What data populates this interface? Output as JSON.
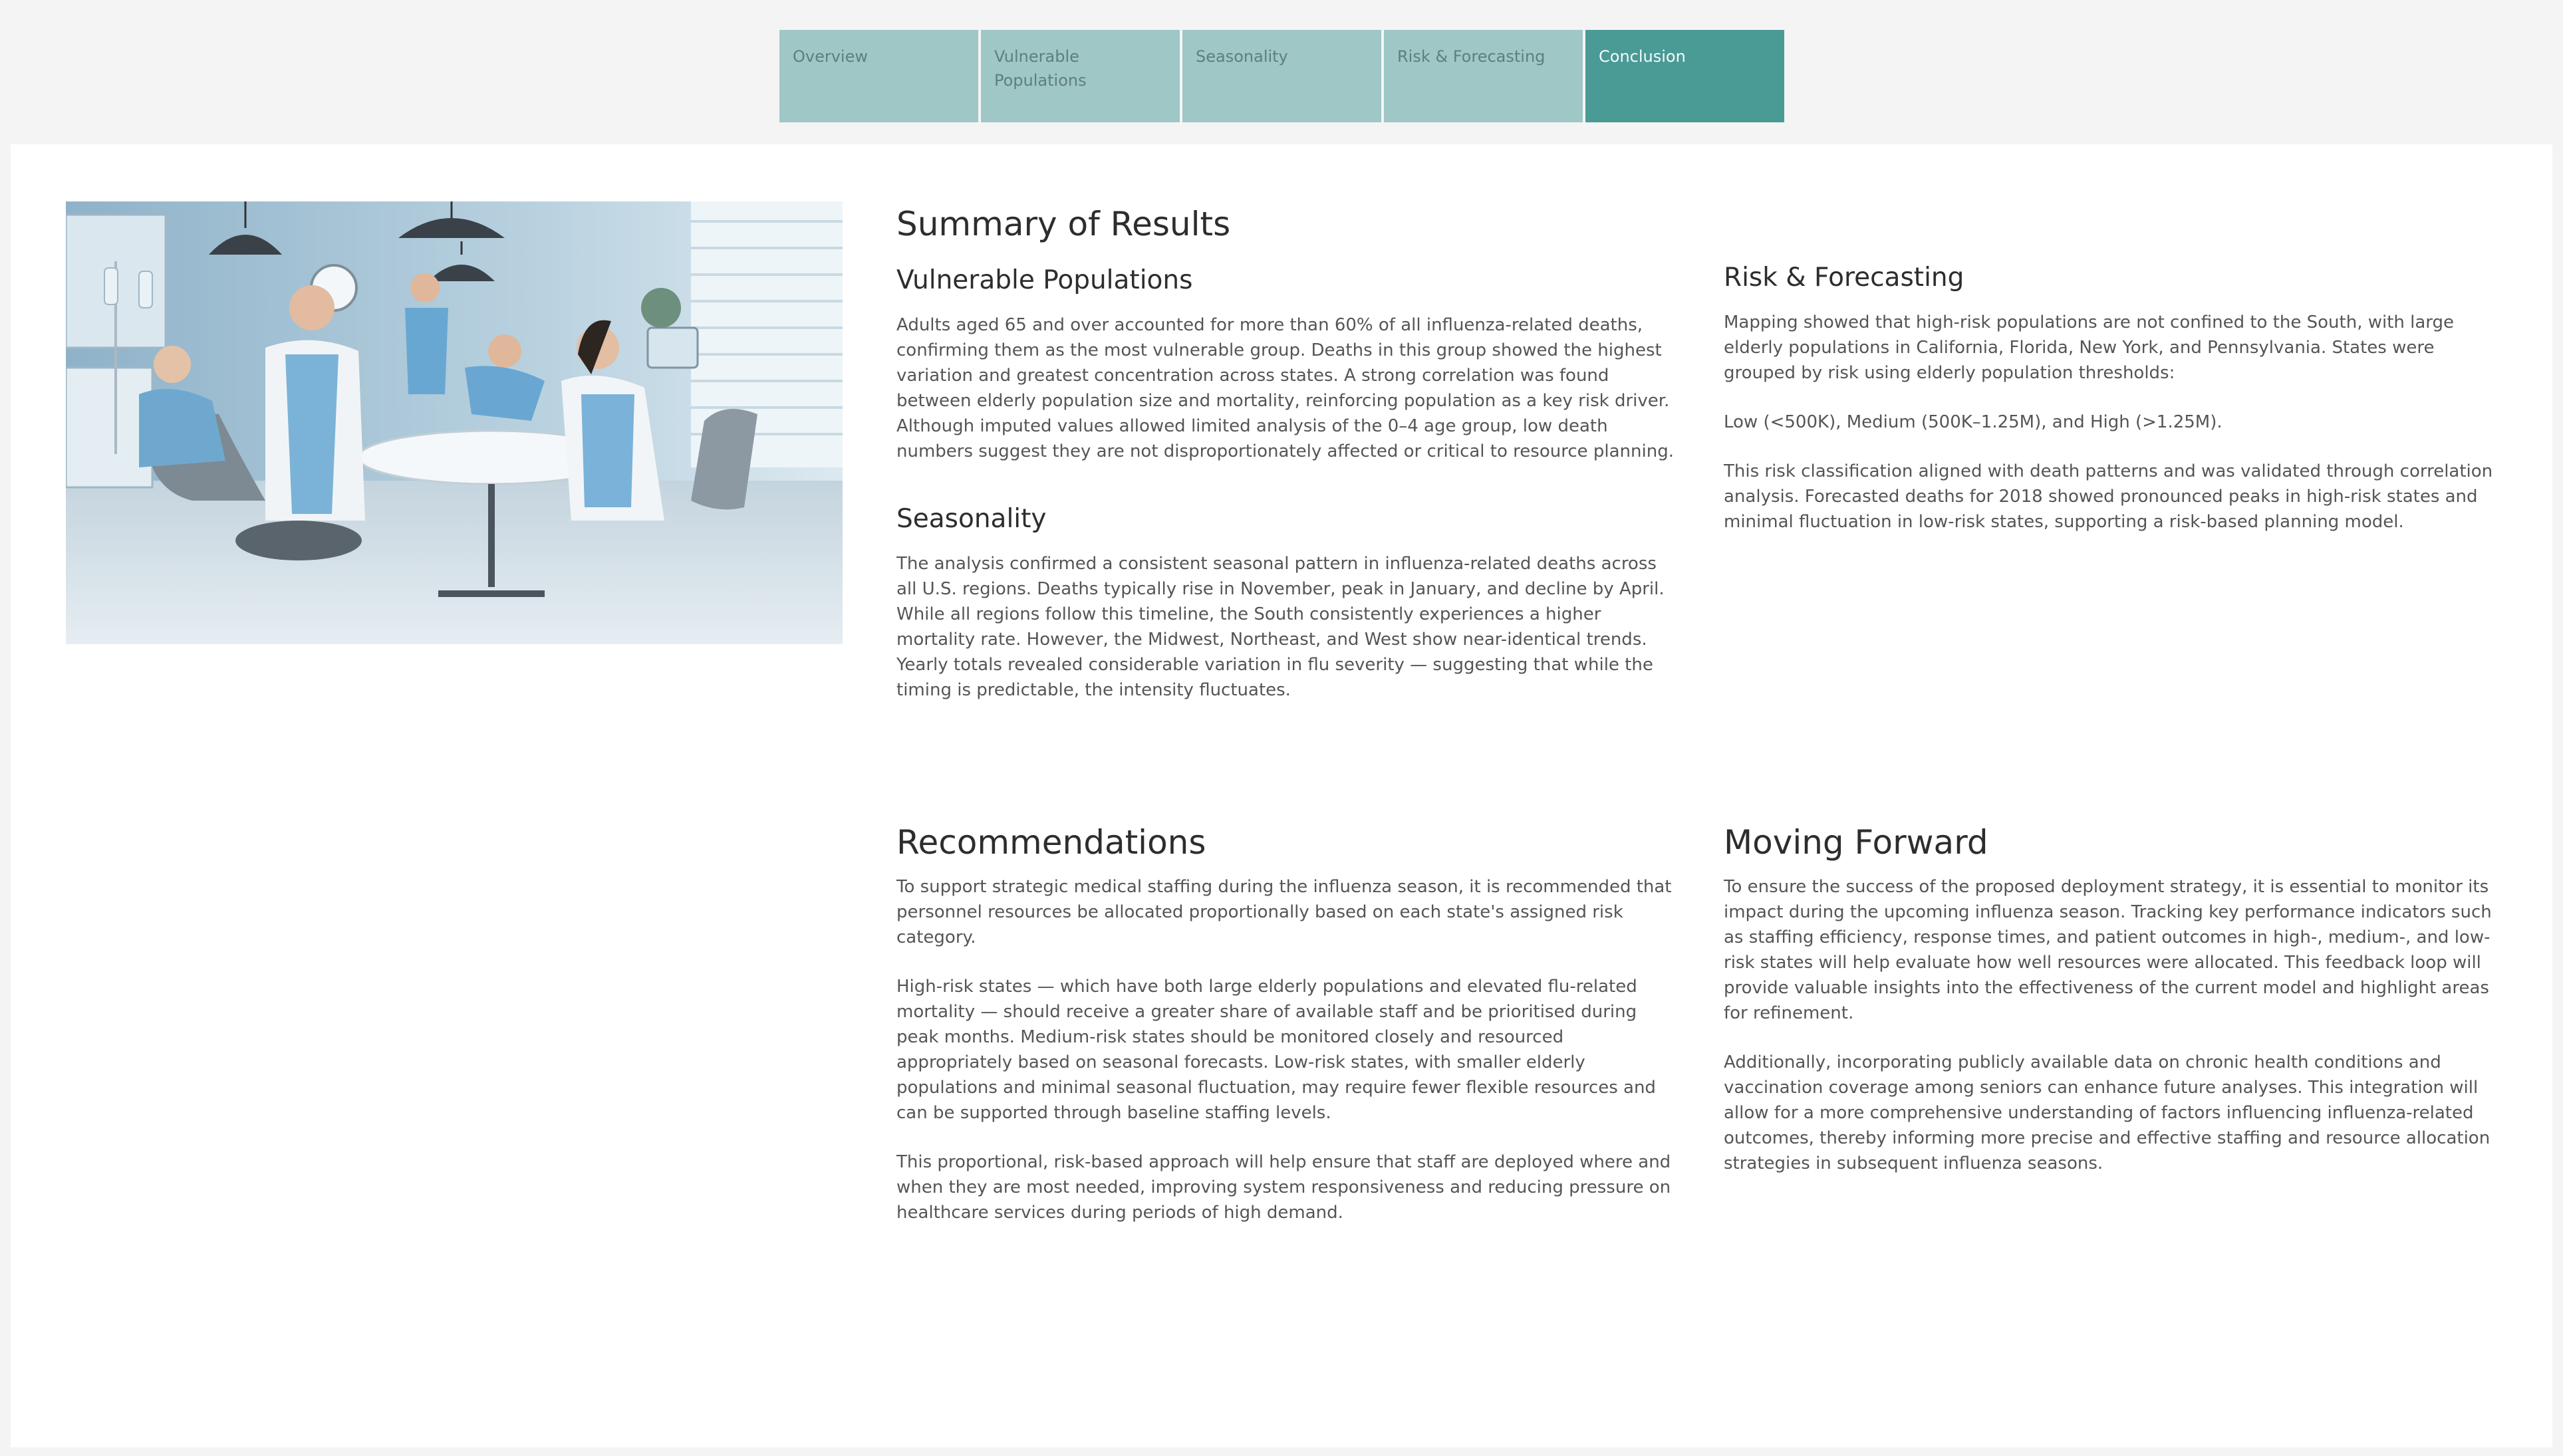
{
  "tabs": [
    {
      "label": "Overview",
      "active": false
    },
    {
      "label": "Vulnerable Populations",
      "active": false
    },
    {
      "label": "Seasonality",
      "active": false
    },
    {
      "label": "Risk & Forecasting",
      "active": false
    },
    {
      "label": "Conclusion",
      "active": true
    }
  ],
  "hero_image": {
    "icon": "medical-staff-lounge-illustration"
  },
  "summary": {
    "title": "Summary of Results",
    "vulnerable": {
      "heading": "Vulnerable Populations",
      "text": "Adults aged 65 and over accounted for more than 60% of all influenza-related deaths, confirming them as the most vulnerable group. Deaths in this group showed the highest variation and greatest concentration across states. A strong correlation was found between elderly population size and mortality, reinforcing population as a key risk driver. Although imputed values allowed limited analysis of the 0–4 age group, low death numbers suggest they are not disproportionately affected or critical to resource planning."
    },
    "seasonality": {
      "heading": "Seasonality",
      "text": "The analysis confirmed a consistent seasonal pattern in influenza-related deaths across all U.S. regions. Deaths typically rise in November, peak in January, and decline by April. While all regions follow this timeline, the South consistently experiences a higher mortality rate. However, the Midwest, Northeast, and West show near-identical trends. Yearly totals revealed considerable variation in flu severity — suggesting that while the timing is predictable, the intensity fluctuates."
    }
  },
  "risk": {
    "heading": "Risk & Forecasting",
    "p1": "Mapping showed that high-risk populations are not confined to the South, with large elderly populations in California, Florida, New York, and Pennsylvania. States were grouped by risk using elderly population thresholds:",
    "p2": "Low (<500K), Medium (500K–1.25M), and High (>1.25M).",
    "p3": "This risk classification aligned with death patterns and was validated through correlation analysis. Forecasted deaths for 2018 showed pronounced peaks in high-risk states and minimal fluctuation in low-risk states, supporting a risk-based planning model."
  },
  "recommendations": {
    "heading": "Recommendations",
    "p1": "To support strategic medical staffing during the influenza season, it is recommended that personnel resources be allocated proportionally based on each state's assigned risk category.",
    "p2": "High-risk states — which have both large elderly populations and elevated flu-related mortality — should receive a greater share of available staff and be prioritised during peak months. Medium-risk states should be monitored closely and resourced appropriately based on seasonal forecasts. Low-risk states, with smaller elderly populations and minimal seasonal fluctuation, may require fewer flexible resources and can be supported through baseline staffing levels.",
    "p3": "This proportional, risk-based approach will help ensure that staff are deployed where and when they are most needed, improving system responsiveness and reducing pressure on healthcare services during periods of high demand."
  },
  "moving_forward": {
    "heading": "Moving Forward",
    "p1": "To ensure the success of the proposed deployment strategy, it is essential to monitor its impact during the upcoming influenza season. Tracking key performance indicators such as staffing efficiency, response times, and patient outcomes in high-, medium-, and low-risk states will help evaluate how well resources were allocated. This feedback loop will provide valuable insights into the effectiveness of the current model and highlight areas for refinement.",
    "p2": "Additionally, incorporating publicly available data on chronic health conditions and vaccination coverage among seniors can enhance future analyses. This integration will allow for a more comprehensive understanding of factors influencing influenza-related outcomes, thereby informing more precise and effective staffing and resource allocation strategies in subsequent influenza seasons."
  }
}
